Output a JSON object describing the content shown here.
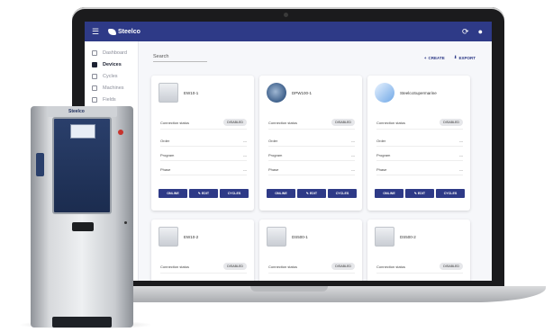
{
  "header": {
    "menu_icon": "menu-icon",
    "brand": "Steelco",
    "refresh_icon": "refresh-icon",
    "account_icon": "account-icon"
  },
  "sidebar": {
    "items": [
      {
        "label": "Dashboard",
        "icon": "dashboard-icon",
        "active": false
      },
      {
        "label": "Devices",
        "icon": "devices-icon",
        "active": true
      },
      {
        "label": "Cycles",
        "icon": "cycles-icon",
        "active": false
      },
      {
        "label": "Machines",
        "icon": "machines-icon",
        "active": false
      },
      {
        "label": "Fields",
        "icon": "fields-icon",
        "active": false
      }
    ]
  },
  "main": {
    "search_placeholder": "Search",
    "actions": [
      {
        "label": "CREATE",
        "icon": "plus-icon"
      },
      {
        "label": "EXPORT",
        "icon": "download-icon"
      }
    ],
    "labels": {
      "connection_status": "Connection status",
      "order": "Order",
      "program": "Program",
      "phase": "Phase",
      "empty": "---"
    },
    "buttons": {
      "online": "ONLINE",
      "edit": "EDIT",
      "cycles": "CYCLES"
    },
    "cards": [
      {
        "name": "EW10-1",
        "status": "DISABLED",
        "thumb": "machine"
      },
      {
        "name": "DPW100-1",
        "status": "DISABLED",
        "thumb": "gear"
      },
      {
        "name": "SteelcoSupermarine",
        "status": "DISABLED",
        "thumb": "blue"
      },
      {
        "name": "EW10-2",
        "status": "DISABLED",
        "thumb": "machine"
      },
      {
        "name": "DS500-1",
        "status": "DISABLED",
        "thumb": "machine"
      },
      {
        "name": "DS500-2",
        "status": "DISABLED",
        "thumb": "machine"
      }
    ]
  },
  "device": {
    "brand": "Steelco"
  },
  "colors": {
    "primary": "#2e3a87",
    "background": "#f6f7fa"
  }
}
